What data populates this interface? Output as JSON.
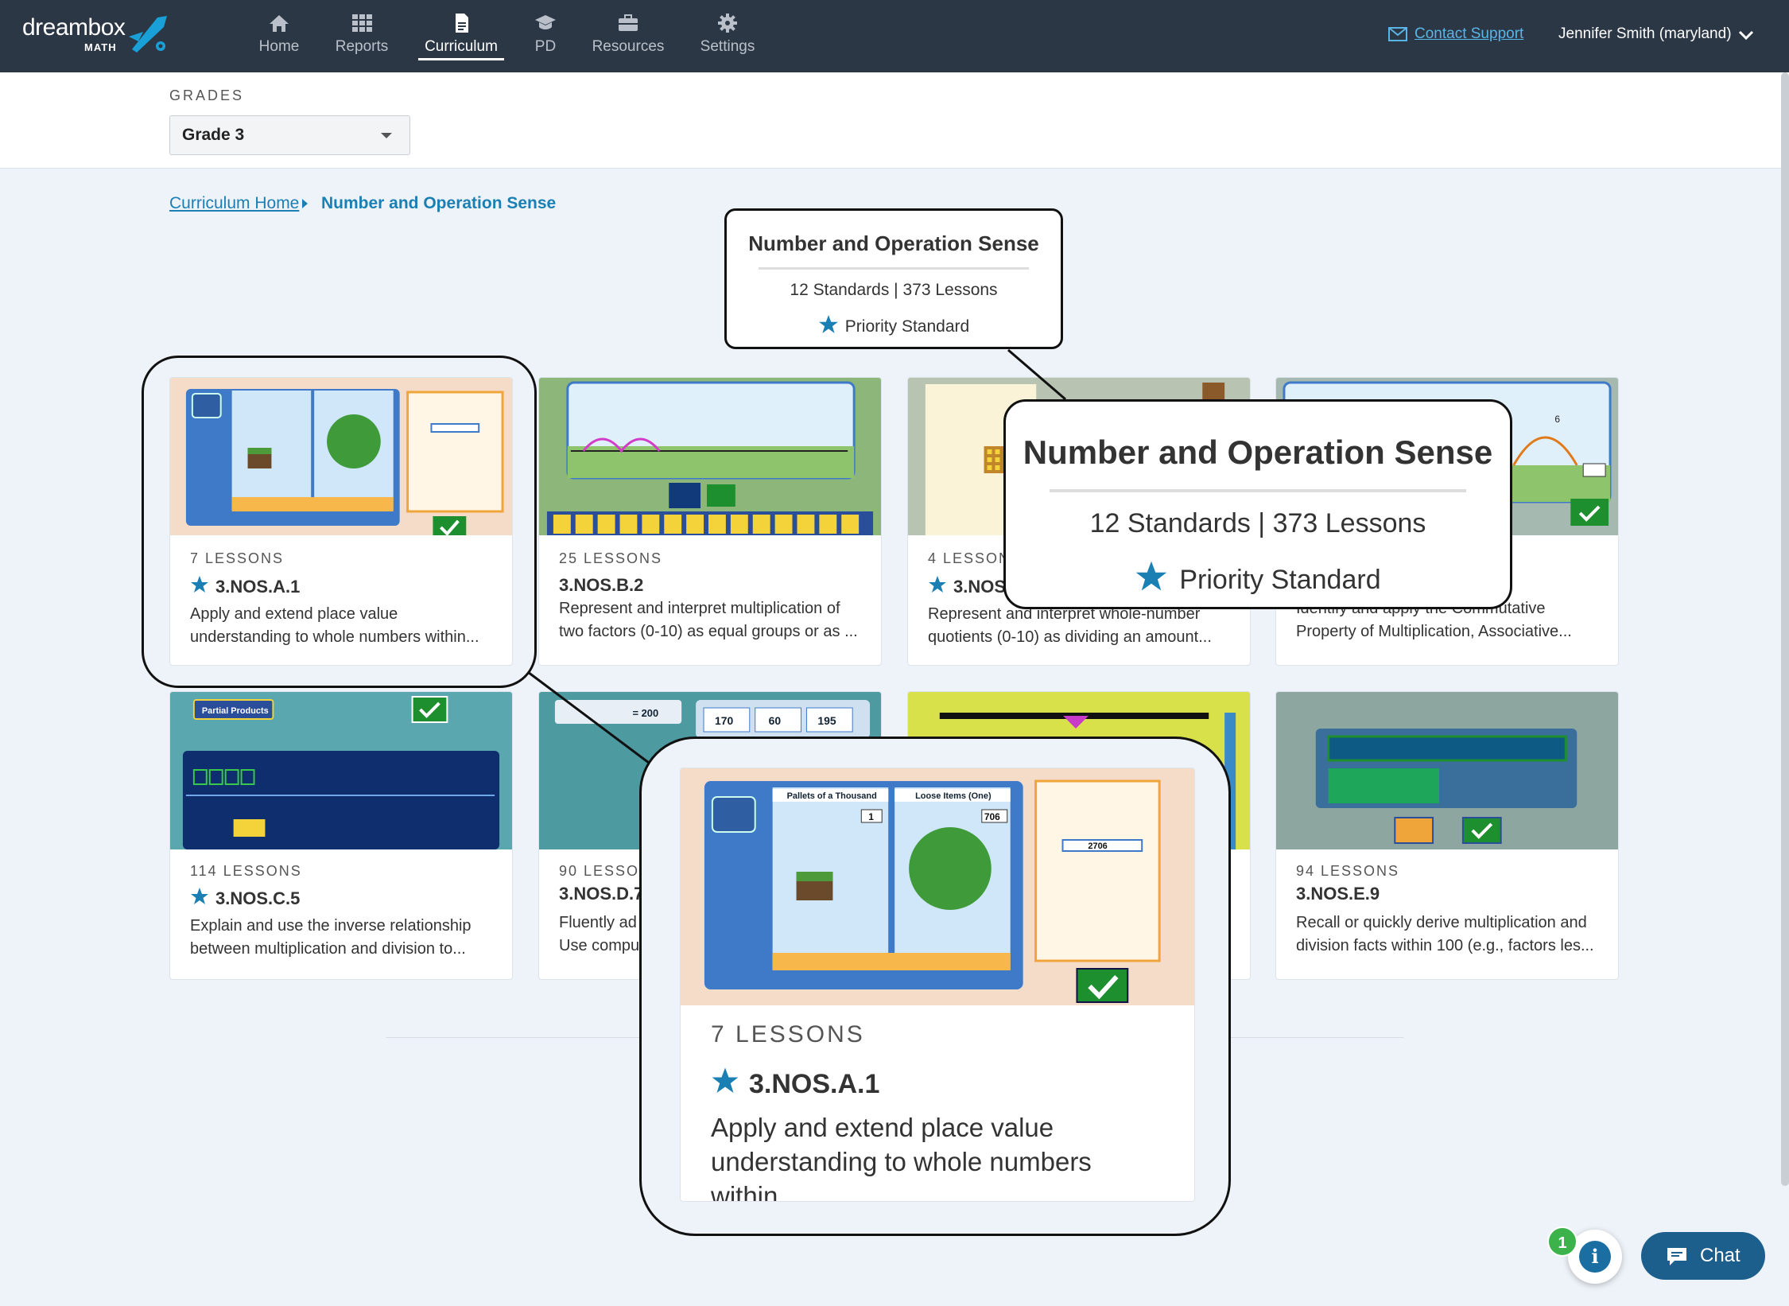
{
  "brand": {
    "wordmark": "dreambox",
    "sub": "MATH"
  },
  "nav": [
    {
      "label": "Home",
      "icon": "home-icon"
    },
    {
      "label": "Reports",
      "icon": "grid-icon"
    },
    {
      "label": "Curriculum",
      "icon": "document-icon",
      "active": true
    },
    {
      "label": "PD",
      "icon": "graduation-cap-icon"
    },
    {
      "label": "Resources",
      "icon": "briefcase-icon"
    },
    {
      "label": "Settings",
      "icon": "gear-icon"
    }
  ],
  "support": {
    "label": "Contact Support"
  },
  "user": {
    "name": "Jennifer Smith (maryland)"
  },
  "grades": {
    "label": "GRADES",
    "selected": "Grade 3"
  },
  "breadcrumb": {
    "home": "Curriculum Home",
    "current": "Number and Operation Sense"
  },
  "summary": {
    "title": "Number and Operation Sense",
    "stats": "12 Standards | 373 Lessons",
    "legend": "Priority Standard"
  },
  "cards": [
    {
      "count": "7 LESSONS",
      "code": "3.NOS.A.1",
      "priority": true,
      "desc": "Apply and extend place value understanding to whole numbers within..."
    },
    {
      "count": "25 LESSONS",
      "code": "3.NOS.B.2",
      "priority": false,
      "desc": "Represent and interpret multiplication of two factors (0-10) as equal groups or as ..."
    },
    {
      "count": "4 LESSONS",
      "code": "3.NOS",
      "priority": true,
      "desc": "Represent and interpret whole-number quotients (0-10) as dividing an amount..."
    },
    {
      "count": "",
      "code": "",
      "priority": false,
      "desc": "Identify and apply the Commutative Property of Multiplication, Associative..."
    },
    {
      "count": "114 LESSONS",
      "code": "3.NOS.C.5",
      "priority": true,
      "desc": "Explain and use the inverse relationship between multiplication and division to..."
    },
    {
      "count": "90 LESSON",
      "code": "3.NOS.D.7",
      "priority": false,
      "desc": "Fluently ad Use compu"
    },
    {
      "count": "",
      "code": "",
      "priority": false,
      "desc": ""
    },
    {
      "count": "94 LESSONS",
      "code": "3.NOS.E.9",
      "priority": false,
      "desc": "Recall or quickly derive multiplication and division facts within 100 (e.g., factors les..."
    }
  ],
  "thumb_text": {
    "pallets": "Pallets of a Thousand",
    "loose": "Loose Items (One)",
    "pallets_count": "1",
    "loose_count": "706",
    "total": "2706",
    "notepad_a": "Pallets of a Thousand",
    "notepad_b": "Loose Items (One)",
    "q": "?",
    "partial": "Partial Products",
    "nums": [
      "170",
      "60",
      "195"
    ],
    "eq": "= 200",
    "hop": "6"
  },
  "zoom_card": {
    "count": "7 LESSONS",
    "code": "3.NOS.A.1",
    "desc": "Apply and extend place value understanding to whole numbers within..."
  },
  "chat": {
    "label": "Chat",
    "badge": "1",
    "info": "i"
  },
  "colors": {
    "nav_bg": "#2c3746",
    "accent": "#1a7fb3",
    "star": "#1a7fb3",
    "page_bg": "#eef3f9"
  }
}
